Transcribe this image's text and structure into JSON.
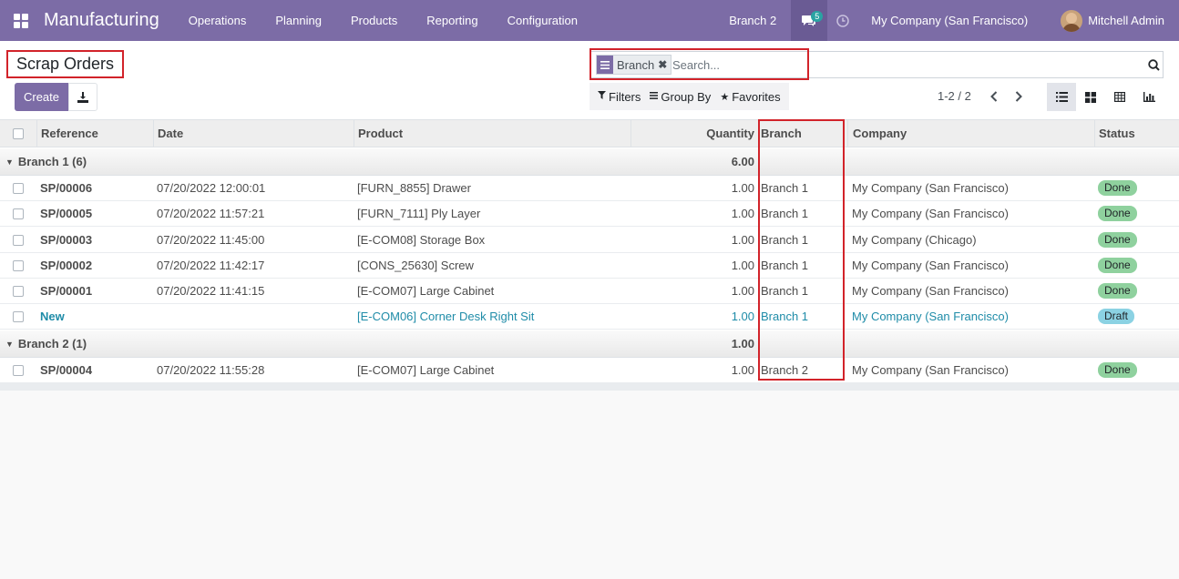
{
  "navbar": {
    "app_name": "Manufacturing",
    "menu": [
      "Operations",
      "Planning",
      "Products",
      "Reporting",
      "Configuration"
    ],
    "branch": "Branch 2",
    "chat_count": "5",
    "company": "My Company (San Francisco)",
    "user": "Mitchell Admin",
    "bg_color": "#7c6ca6"
  },
  "control_panel": {
    "title": "Scrap Orders",
    "create_label": "Create",
    "search": {
      "facet_label": "Branch",
      "placeholder": "Search..."
    },
    "filters_label": "Filters",
    "groupby_label": "Group By",
    "favorites_label": "Favorites",
    "pager": "1-2 / 2"
  },
  "table": {
    "columns": [
      "Reference",
      "Date",
      "Product",
      "Quantity",
      "Branch",
      "Company",
      "Status"
    ],
    "groups": [
      {
        "label": "Branch 1 (6)",
        "total": "6.00",
        "rows": [
          {
            "ref": "SP/00006",
            "date": "07/20/2022 12:00:01",
            "product": "[FURN_8855] Drawer",
            "qty": "1.00",
            "branch": "Branch 1",
            "company": "My Company (San Francisco)",
            "status": "Done"
          },
          {
            "ref": "SP/00005",
            "date": "07/20/2022 11:57:21",
            "product": "[FURN_7111] Ply Layer",
            "qty": "1.00",
            "branch": "Branch 1",
            "company": "My Company (San Francisco)",
            "status": "Done"
          },
          {
            "ref": "SP/00003",
            "date": "07/20/2022 11:45:00",
            "product": "[E-COM08] Storage Box",
            "qty": "1.00",
            "branch": "Branch 1",
            "company": "My Company (Chicago)",
            "status": "Done"
          },
          {
            "ref": "SP/00002",
            "date": "07/20/2022 11:42:17",
            "product": "[CONS_25630] Screw",
            "qty": "1.00",
            "branch": "Branch 1",
            "company": "My Company (San Francisco)",
            "status": "Done"
          },
          {
            "ref": "SP/00001",
            "date": "07/20/2022 11:41:15",
            "product": "[E-COM07] Large Cabinet",
            "qty": "1.00",
            "branch": "Branch 1",
            "company": "My Company (San Francisco)",
            "status": "Done"
          },
          {
            "ref": "New",
            "date": "",
            "product": "[E-COM06] Corner Desk Right Sit",
            "qty": "1.00",
            "branch": "Branch 1",
            "company": "My Company (San Francisco)",
            "status": "Draft"
          }
        ]
      },
      {
        "label": "Branch 2 (1)",
        "total": "1.00",
        "rows": [
          {
            "ref": "SP/00004",
            "date": "07/20/2022 11:55:28",
            "product": "[E-COM07] Large Cabinet",
            "qty": "1.00",
            "branch": "Branch 2",
            "company": "My Company (San Francisco)",
            "status": "Done"
          }
        ]
      }
    ]
  },
  "icons": [
    "apps-grid-icon",
    "chat-icon",
    "clock-icon",
    "download-icon",
    "search-icon",
    "list-view-icon",
    "kanban-view-icon",
    "pivot-view-icon",
    "graph-view-icon",
    "filter-icon",
    "group-by-icon",
    "star-icon"
  ],
  "colors": {
    "done_badge": "#8fd19e",
    "draft_badge": "#8bd2e3",
    "highlight": "#d2232a"
  }
}
